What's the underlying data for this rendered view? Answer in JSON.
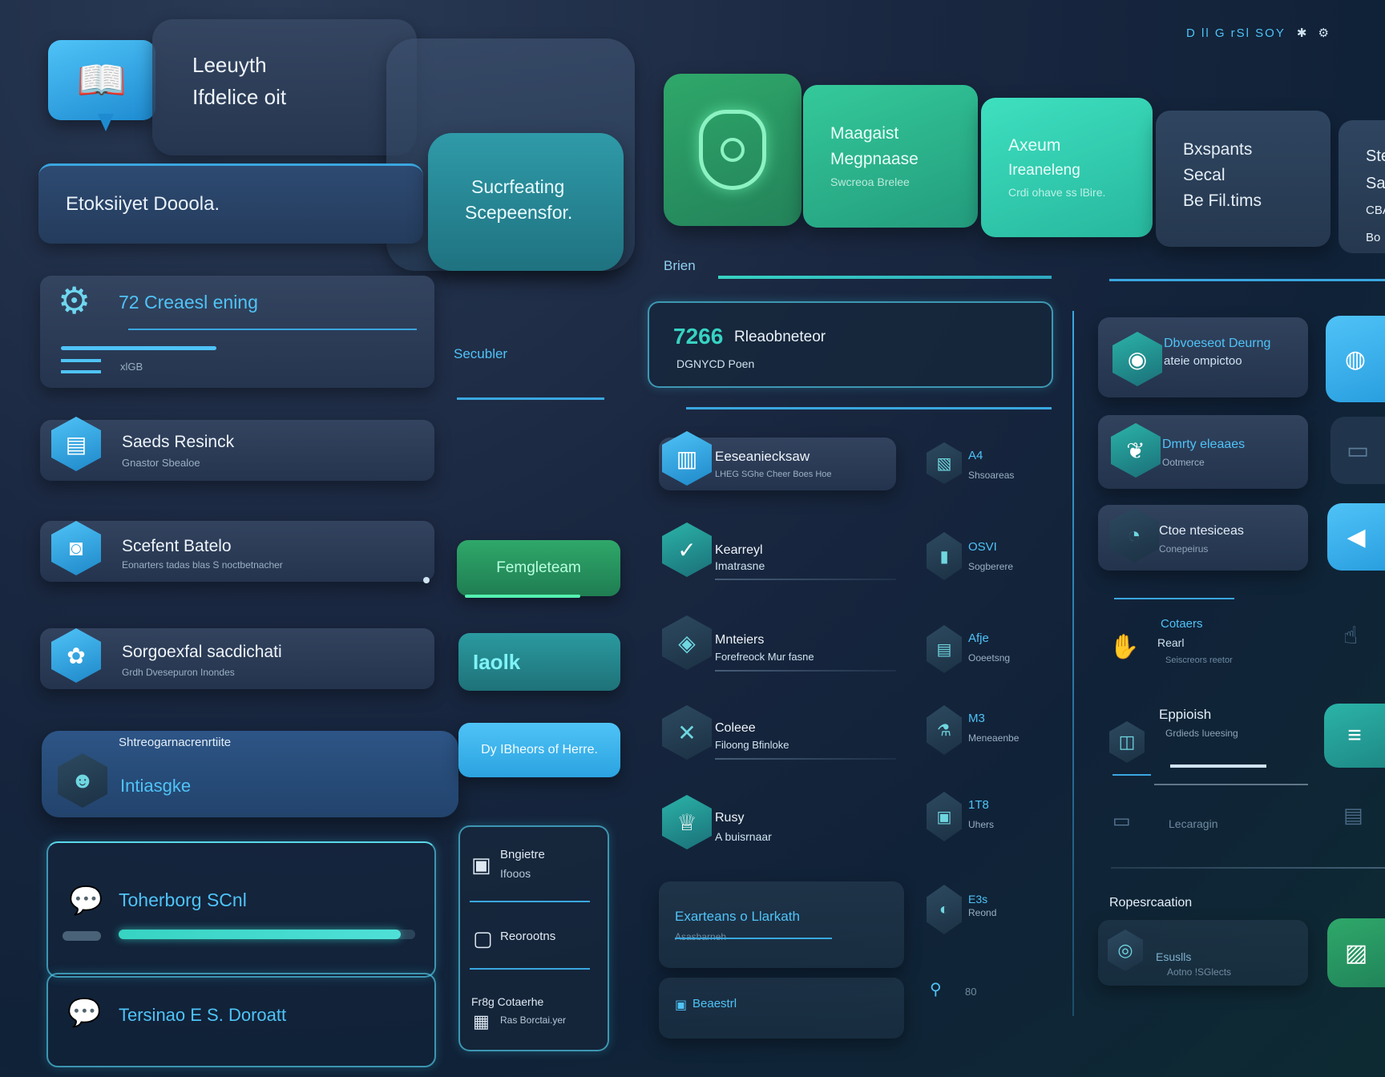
{
  "header": {
    "title_line1": "Leeuyth",
    "title_line2": "Ifdelice oit",
    "search_label": "Etoksiiyet Dooola.",
    "callout_line1": "Sucrfeating",
    "callout_line2": "Scepeensfor.",
    "status_text": "D ll G rSl SOY"
  },
  "tiles": [
    {
      "t1": "Maagaist",
      "t2": "Megpnaase",
      "t3": "Swcreoa Brelee"
    },
    {
      "t1": "Axeum",
      "t2": "Ireaneleng",
      "t3": "Crdi ohave ss lBire."
    },
    {
      "t1": "Bxspants",
      "t2": "Secal",
      "t3": "Be Fil.tims"
    },
    {
      "t1": "Ste",
      "t2": "Sa",
      "t3": "CBA",
      "t4": "Bo"
    }
  ],
  "left_panel": {
    "section_title": "72 Creaesl ening",
    "section_sub": "xlGB",
    "side_link": "Secubler",
    "items": [
      {
        "title": "Saeds Resinck",
        "sub": "Gnastor Sbealoe"
      },
      {
        "title": "Scefent Batelo",
        "sub": "Eonarters tadas blas S noctbetnacher"
      },
      {
        "title": "Sorgoexfal sacdichati",
        "sub": "Grdh Dvesepuron Inondes"
      },
      {
        "title": "Intiasgke",
        "label_above": "Shtreogarnacrenrtiite"
      }
    ],
    "buttons": {
      "primary": "Femgleteam",
      "secondary": "Iaolk",
      "cta": "Dy IBheors of Herre."
    },
    "progress_cards": [
      {
        "title": "Toherborg SCnl",
        "progress": 0.95
      },
      {
        "title": "Tersinao E S. Doroatt"
      }
    ],
    "mini_list": [
      {
        "line1": "Bngietre",
        "line2": "Ifooos"
      },
      {
        "line1": "Reorootns"
      },
      {
        "line1": "Fr8g Cotaerhe",
        "line2": "Ras Borctai.yer"
      }
    ]
  },
  "middle_panel": {
    "header_label": "Brien",
    "highlight": {
      "number": "7266",
      "title": "Rleaobneteor",
      "sub": "DGNYCD Poen"
    },
    "items": [
      {
        "title": "Eeseaniecksaw",
        "sub": "LHEG SGhe Cheer Boes Hoe",
        "side_title": "A4",
        "side_sub": "Shsoareas"
      },
      {
        "title": "Kearreyl",
        "sub": "Imatrasne",
        "side_title": "OSVI",
        "side_sub": "Sogberere"
      },
      {
        "title": "Mnteiers",
        "sub": "Forefreock Mur fasne",
        "side_title": "Afje",
        "side_sub": "Ooeetsng"
      },
      {
        "title": "Coleee",
        "sub": "Filoong Bfinloke",
        "side_title": "M3",
        "side_sub": "Meneaenbe"
      },
      {
        "title": "Rusy",
        "sub": "A buisrnaar",
        "side_title": "1T8",
        "side_sub": "Uhers"
      }
    ],
    "bottom_card": {
      "title": "Exarteans o Llarkath",
      "sub": "Asasbarneh"
    },
    "bottom_right": {
      "title": "E3s",
      "sub": "Reond"
    },
    "footer_link": "Beaestrl",
    "footer_small": "80"
  },
  "right_panel": {
    "items": [
      {
        "title": "Dbvoeseot Deurng",
        "sub": "ateie ompictoo"
      },
      {
        "title": "Dmrty eleaaes",
        "sub": "Ootmerce"
      },
      {
        "title": "Ctoe ntesiceas",
        "sub": "Conepeirus"
      },
      {
        "title": "Cotaers",
        "sub": "Rearl",
        "sub2": "Seiscreors reetor"
      },
      {
        "title": "Eppioish",
        "sub": "Grdieds Iueesing"
      },
      {
        "title": "Lecaragin"
      }
    ],
    "section_title": "Ropesrcaation",
    "section_item": {
      "title": "Esuslls",
      "sub": "Aotno !SGlects"
    }
  },
  "colors": {
    "accent_teal": "#37d3c2",
    "accent_blue": "#4fc3f7",
    "tile_green": "#2fa86a",
    "bg": "#16243a"
  }
}
